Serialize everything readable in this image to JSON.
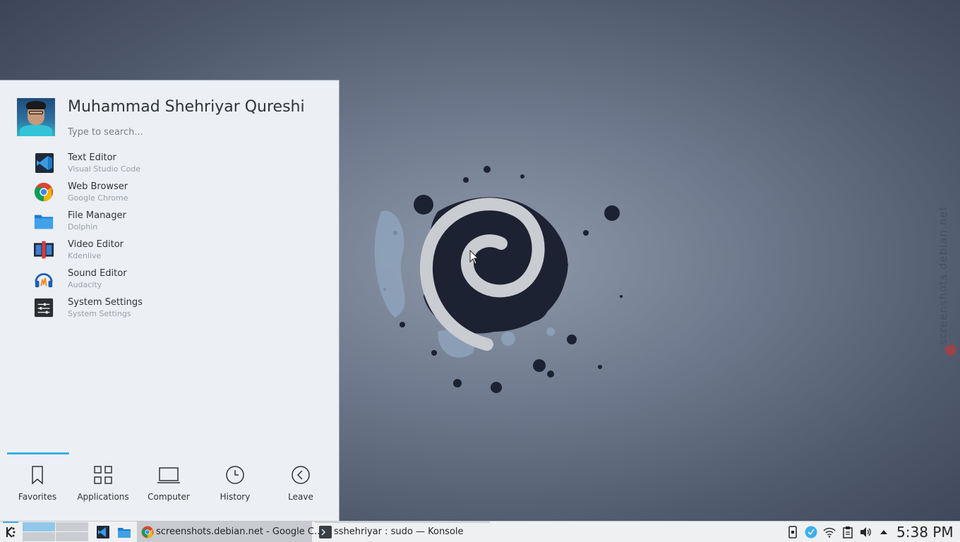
{
  "desktop": {
    "watermark": "screenshots.debian.net"
  },
  "launcher": {
    "user_name": "Muhammad Shehriyar Qureshi",
    "search_placeholder": "Type to search...",
    "favorites": [
      {
        "title": "Text Editor",
        "subtitle": "Visual Studio Code",
        "icon": "vscode-icon"
      },
      {
        "title": "Web Browser",
        "subtitle": "Google Chrome",
        "icon": "chrome-icon"
      },
      {
        "title": "File Manager",
        "subtitle": "Dolphin",
        "icon": "folder-icon"
      },
      {
        "title": "Video Editor",
        "subtitle": "Kdenlive",
        "icon": "film-icon"
      },
      {
        "title": "Sound Editor",
        "subtitle": "Audacity",
        "icon": "headphones-icon"
      },
      {
        "title": "System Settings",
        "subtitle": "System Settings",
        "icon": "settings-icon"
      }
    ],
    "tabs": [
      {
        "label": "Favorites",
        "icon": "bookmark-icon",
        "active": true
      },
      {
        "label": "Applications",
        "icon": "grid-icon"
      },
      {
        "label": "Computer",
        "icon": "laptop-icon"
      },
      {
        "label": "History",
        "icon": "clock-icon"
      },
      {
        "label": "Leave",
        "icon": "back-arrow-icon"
      }
    ]
  },
  "taskbar": {
    "tasks": [
      {
        "label": "screenshots.debian.net - Google C...",
        "icon": "chrome-icon",
        "active": true
      },
      {
        "label": "sshehriyar : sudo — Konsole",
        "icon": "terminal-icon"
      }
    ],
    "clock": "5:38 PM",
    "tray_icons": [
      "kdeconnect-icon",
      "update-notifier-icon",
      "wifi-icon",
      "clipboard-icon",
      "volume-icon",
      "expand-arrow-icon"
    ]
  },
  "colors": {
    "accent": "#3daee9",
    "launcher_bg": "#eceff3",
    "taskbar_bg": "#eff0f1"
  }
}
